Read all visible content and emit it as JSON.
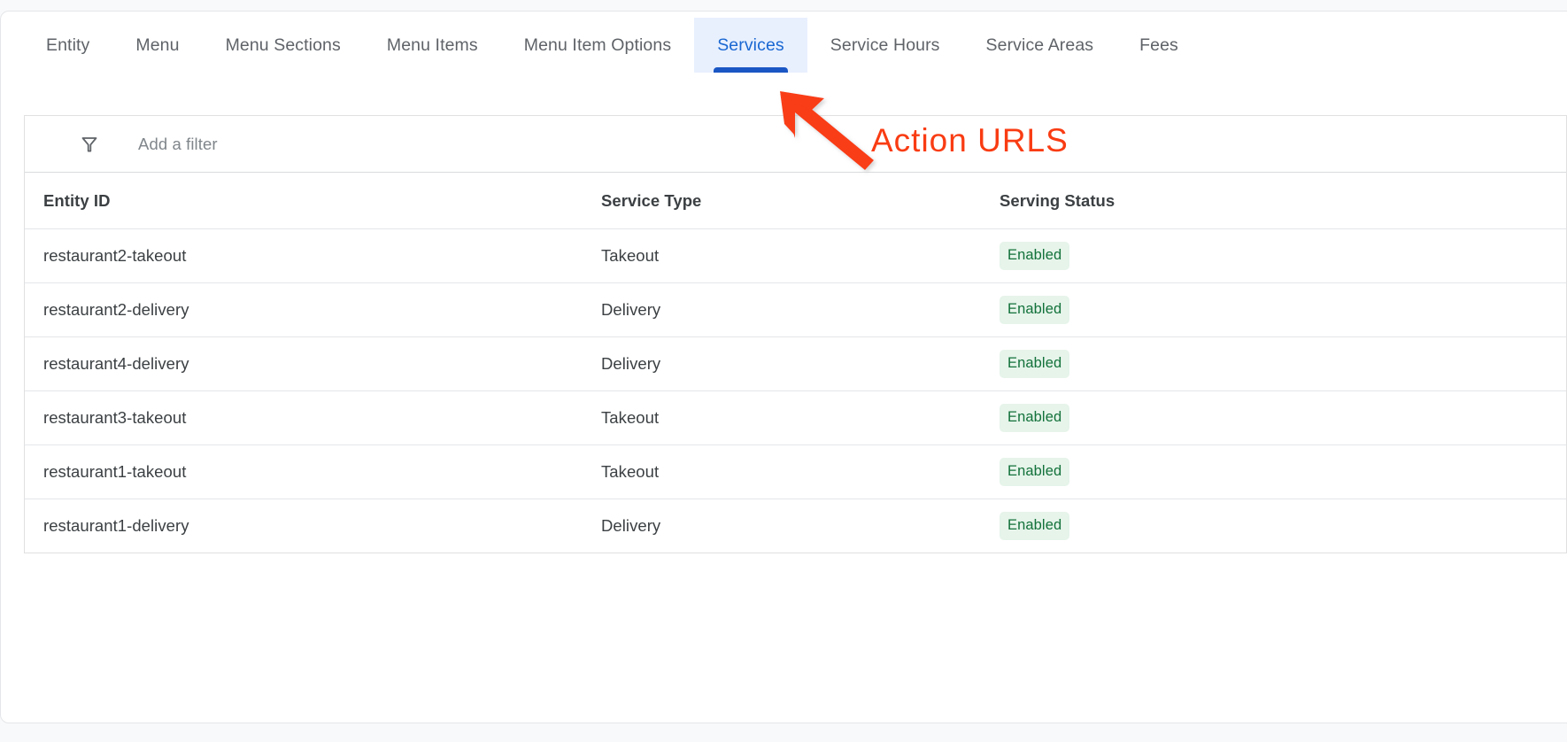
{
  "tabs": [
    {
      "label": "Entity",
      "active": false
    },
    {
      "label": "Menu",
      "active": false
    },
    {
      "label": "Menu Sections",
      "active": false
    },
    {
      "label": "Menu Items",
      "active": false
    },
    {
      "label": "Menu Item Options",
      "active": false
    },
    {
      "label": "Services",
      "active": true
    },
    {
      "label": "Service Hours",
      "active": false
    },
    {
      "label": "Service Areas",
      "active": false
    },
    {
      "label": "Fees",
      "active": false
    }
  ],
  "filter": {
    "icon": "filter-funnel-icon",
    "placeholder": "Add a filter",
    "value": ""
  },
  "table": {
    "columns": [
      "Entity ID",
      "Service Type",
      "Serving Status"
    ],
    "rows": [
      {
        "entity_id": "restaurant2-takeout",
        "service_type": "Takeout",
        "serving_status": "Enabled"
      },
      {
        "entity_id": "restaurant2-delivery",
        "service_type": "Delivery",
        "serving_status": "Enabled"
      },
      {
        "entity_id": "restaurant4-delivery",
        "service_type": "Delivery",
        "serving_status": "Enabled"
      },
      {
        "entity_id": "restaurant3-takeout",
        "service_type": "Takeout",
        "serving_status": "Enabled"
      },
      {
        "entity_id": "restaurant1-takeout",
        "service_type": "Takeout",
        "serving_status": "Enabled"
      },
      {
        "entity_id": "restaurant1-delivery",
        "service_type": "Delivery",
        "serving_status": "Enabled"
      }
    ]
  },
  "annotation": {
    "text": "Action URLS",
    "color": "#f93c13",
    "arrow": "arrow-pointing-to-services-tab"
  },
  "colors": {
    "active_tab_bg": "#e8f0fe",
    "active_tab_text": "#1967d2",
    "active_tab_underline": "#1a56c4",
    "badge_bg": "#e6f4ea",
    "badge_text": "#12713a",
    "page_bg": "#f8f9fa"
  }
}
